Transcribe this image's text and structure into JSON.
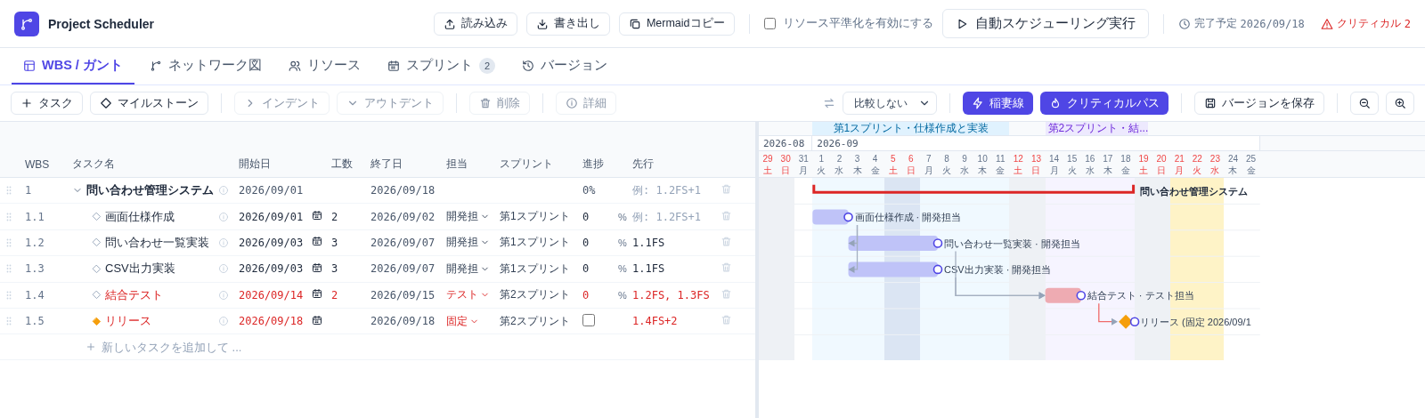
{
  "app": {
    "title": "Project Scheduler"
  },
  "header_actions": [
    {
      "kind": "upload",
      "label": "読み込み"
    },
    {
      "kind": "download",
      "label": "書き出し"
    },
    {
      "kind": "copy",
      "label": "Mermaidコピー"
    }
  ],
  "leveling": {
    "label": "リソース平準化を有効にする",
    "checked": false
  },
  "run_button": {
    "label": "自動スケジューリング実行"
  },
  "finish": {
    "label": "完了予定",
    "date": "2026/09/18"
  },
  "critical": {
    "label": "クリティカル",
    "count": "2"
  },
  "tabs": [
    {
      "kind": "table",
      "label": "WBS / ガント",
      "selected": true
    },
    {
      "kind": "network",
      "label": "ネットワーク図",
      "selected": false
    },
    {
      "kind": "people",
      "label": "リソース",
      "selected": false
    },
    {
      "kind": "calendar",
      "label": "スプリント",
      "badge": "2",
      "selected": false
    },
    {
      "kind": "history",
      "label": "バージョン",
      "selected": false
    }
  ],
  "toolbar": {
    "groups": [
      [
        {
          "kind": "plus",
          "label": "タスク",
          "disabled": false
        },
        {
          "kind": "diamond",
          "label": "マイルストーン",
          "disabled": false
        }
      ],
      [
        {
          "kind": "indent",
          "label": "インデント",
          "disabled": true
        },
        {
          "kind": "outdent",
          "label": "アウトデント",
          "disabled": true
        }
      ],
      [
        {
          "kind": "trash",
          "label": "削除",
          "disabled": true
        }
      ],
      [
        {
          "kind": "info",
          "label": "詳細",
          "disabled": true
        }
      ]
    ],
    "compare": {
      "value": "比較しない"
    },
    "toggles": [
      {
        "kind": "bolt",
        "label": "稲妻線",
        "on": true
      },
      {
        "kind": "flame",
        "label": "クリティカルパス",
        "on": true
      }
    ],
    "save": {
      "label": "バージョンを保存"
    },
    "zoom": [
      {
        "kind": "zoom-out"
      },
      {
        "kind": "zoom-in"
      }
    ]
  },
  "table": {
    "columns": [
      "WBS",
      "タスク名",
      "開始日",
      "工数",
      "終了日",
      "担当",
      "スプリント",
      "進捗",
      "先行"
    ],
    "add_placeholder": "新しいタスクを追加して ..."
  },
  "tasks": [
    {
      "kind": "summary",
      "wbs": "1",
      "name": "問い合わせ管理システム",
      "expanded": true,
      "critical": true,
      "start": "2026/09/01",
      "end": "2026/09/18",
      "progress": "0%",
      "predecessor_placeholder": "例: 1.2FS+1",
      "bar_label": "問い合わせ管理システム",
      "children": [
        {
          "kind": "task",
          "wbs": "1.1",
          "name": "画面仕様作成",
          "critical": false,
          "start": "2026/09/01",
          "effort": "2",
          "end": "2026/09/02",
          "assignee": "開発担",
          "sprint": "第1スプリント",
          "progress": "0",
          "unit": "%",
          "predecessor_placeholder": "例: 1.2FS+1",
          "bar_label": "画面仕様作成 · 開発担当"
        },
        {
          "kind": "task",
          "wbs": "1.2",
          "name": "問い合わせ一覧実装",
          "critical": false,
          "start": "2026/09/03",
          "effort": "3",
          "end": "2026/09/07",
          "assignee": "開発担",
          "sprint": "第1スプリント",
          "progress": "0",
          "unit": "%",
          "predecessor": "1.1FS",
          "bar_label": "問い合わせ一覧実装 · 開発担当"
        },
        {
          "kind": "task",
          "wbs": "1.3",
          "name": "CSV出力実装",
          "critical": false,
          "start": "2026/09/03",
          "effort": "3",
          "end": "2026/09/07",
          "assignee": "開発担",
          "sprint": "第1スプリント",
          "progress": "0",
          "unit": "%",
          "predecessor": "1.1FS",
          "bar_label": "CSV出力実装 · 開発担当"
        },
        {
          "kind": "task",
          "wbs": "1.4",
          "name": "結合テスト",
          "critical": true,
          "start": "2026/09/14",
          "effort": "2",
          "end": "2026/09/15",
          "assignee": "テスト",
          "sprint": "第2スプリント",
          "progress": "0",
          "unit": "%",
          "predecessor": "1.2FS, 1.3FS",
          "bar_label": "結合テスト · テスト担当"
        },
        {
          "kind": "milestone",
          "wbs": "1.5",
          "name": "リリース",
          "critical": true,
          "start": "2026/09/18",
          "end": "2026/09/18",
          "assignee": "固定",
          "sprint": "第2スプリント",
          "done": false,
          "predecessor": "1.4FS+2",
          "bar_label": "リリース (固定 2026/09/1"
        }
      ]
    }
  ],
  "gantt": {
    "sprints": [
      {
        "label": "第1スプリント・仕様作成と実装",
        "color": "#e0f2fe"
      },
      {
        "label": "第2スプリント・結...",
        "color": "#ede9fe"
      }
    ],
    "months": [
      {
        "label": "2026-08",
        "days": [
          {
            "day": "29",
            "weekday": "土",
            "kind": "weekend",
            "in_sprint": false
          },
          {
            "day": "30",
            "weekday": "日",
            "kind": "weekend",
            "in_sprint": false
          },
          {
            "day": "31",
            "weekday": "月",
            "kind": "weekday",
            "in_sprint": false
          }
        ]
      },
      {
        "label": "2026-09",
        "days": [
          {
            "day": "1",
            "weekday": "火",
            "kind": "weekday",
            "in_sprint": true
          },
          {
            "day": "2",
            "weekday": "水",
            "kind": "weekday",
            "in_sprint": true
          },
          {
            "day": "3",
            "weekday": "木",
            "kind": "weekday",
            "in_sprint": true
          },
          {
            "day": "4",
            "weekday": "金",
            "kind": "weekday",
            "in_sprint": true
          },
          {
            "day": "5",
            "weekday": "土",
            "kind": "weekend",
            "in_sprint": true
          },
          {
            "day": "6",
            "weekday": "日",
            "kind": "weekend",
            "in_sprint": true
          },
          {
            "day": "7",
            "weekday": "月",
            "kind": "weekday",
            "in_sprint": true
          },
          {
            "day": "8",
            "weekday": "火",
            "kind": "weekday",
            "in_sprint": true
          },
          {
            "day": "9",
            "weekday": "水",
            "kind": "weekday",
            "in_sprint": true
          },
          {
            "day": "10",
            "weekday": "木",
            "kind": "weekday",
            "in_sprint": true
          },
          {
            "day": "11",
            "weekday": "金",
            "kind": "weekday",
            "in_sprint": true
          },
          {
            "day": "12",
            "weekday": "土",
            "kind": "weekend",
            "in_sprint": false
          },
          {
            "day": "13",
            "weekday": "日",
            "kind": "weekend",
            "in_sprint": false
          },
          {
            "day": "14",
            "weekday": "月",
            "kind": "weekday",
            "in_sprint": true
          },
          {
            "day": "15",
            "weekday": "火",
            "kind": "weekday",
            "in_sprint": true
          },
          {
            "day": "16",
            "weekday": "水",
            "kind": "weekday",
            "in_sprint": true
          },
          {
            "day": "17",
            "weekday": "木",
            "kind": "weekday",
            "in_sprint": true
          },
          {
            "day": "18",
            "weekday": "金",
            "kind": "weekday",
            "in_sprint": true
          },
          {
            "day": "19",
            "weekday": "土",
            "kind": "weekend",
            "in_sprint": false
          },
          {
            "day": "20",
            "weekday": "日",
            "kind": "weekend",
            "in_sprint": false
          },
          {
            "day": "21",
            "weekday": "月",
            "kind": "holiday",
            "in_sprint": false
          },
          {
            "day": "22",
            "weekday": "火",
            "kind": "holiday",
            "in_sprint": false
          },
          {
            "day": "23",
            "weekday": "水",
            "kind": "holiday",
            "in_sprint": false
          },
          {
            "day": "24",
            "weekday": "木",
            "kind": "weekday",
            "in_sprint": false
          },
          {
            "day": "25",
            "weekday": "金",
            "kind": "weekday",
            "in_sprint": false
          }
        ]
      }
    ]
  }
}
